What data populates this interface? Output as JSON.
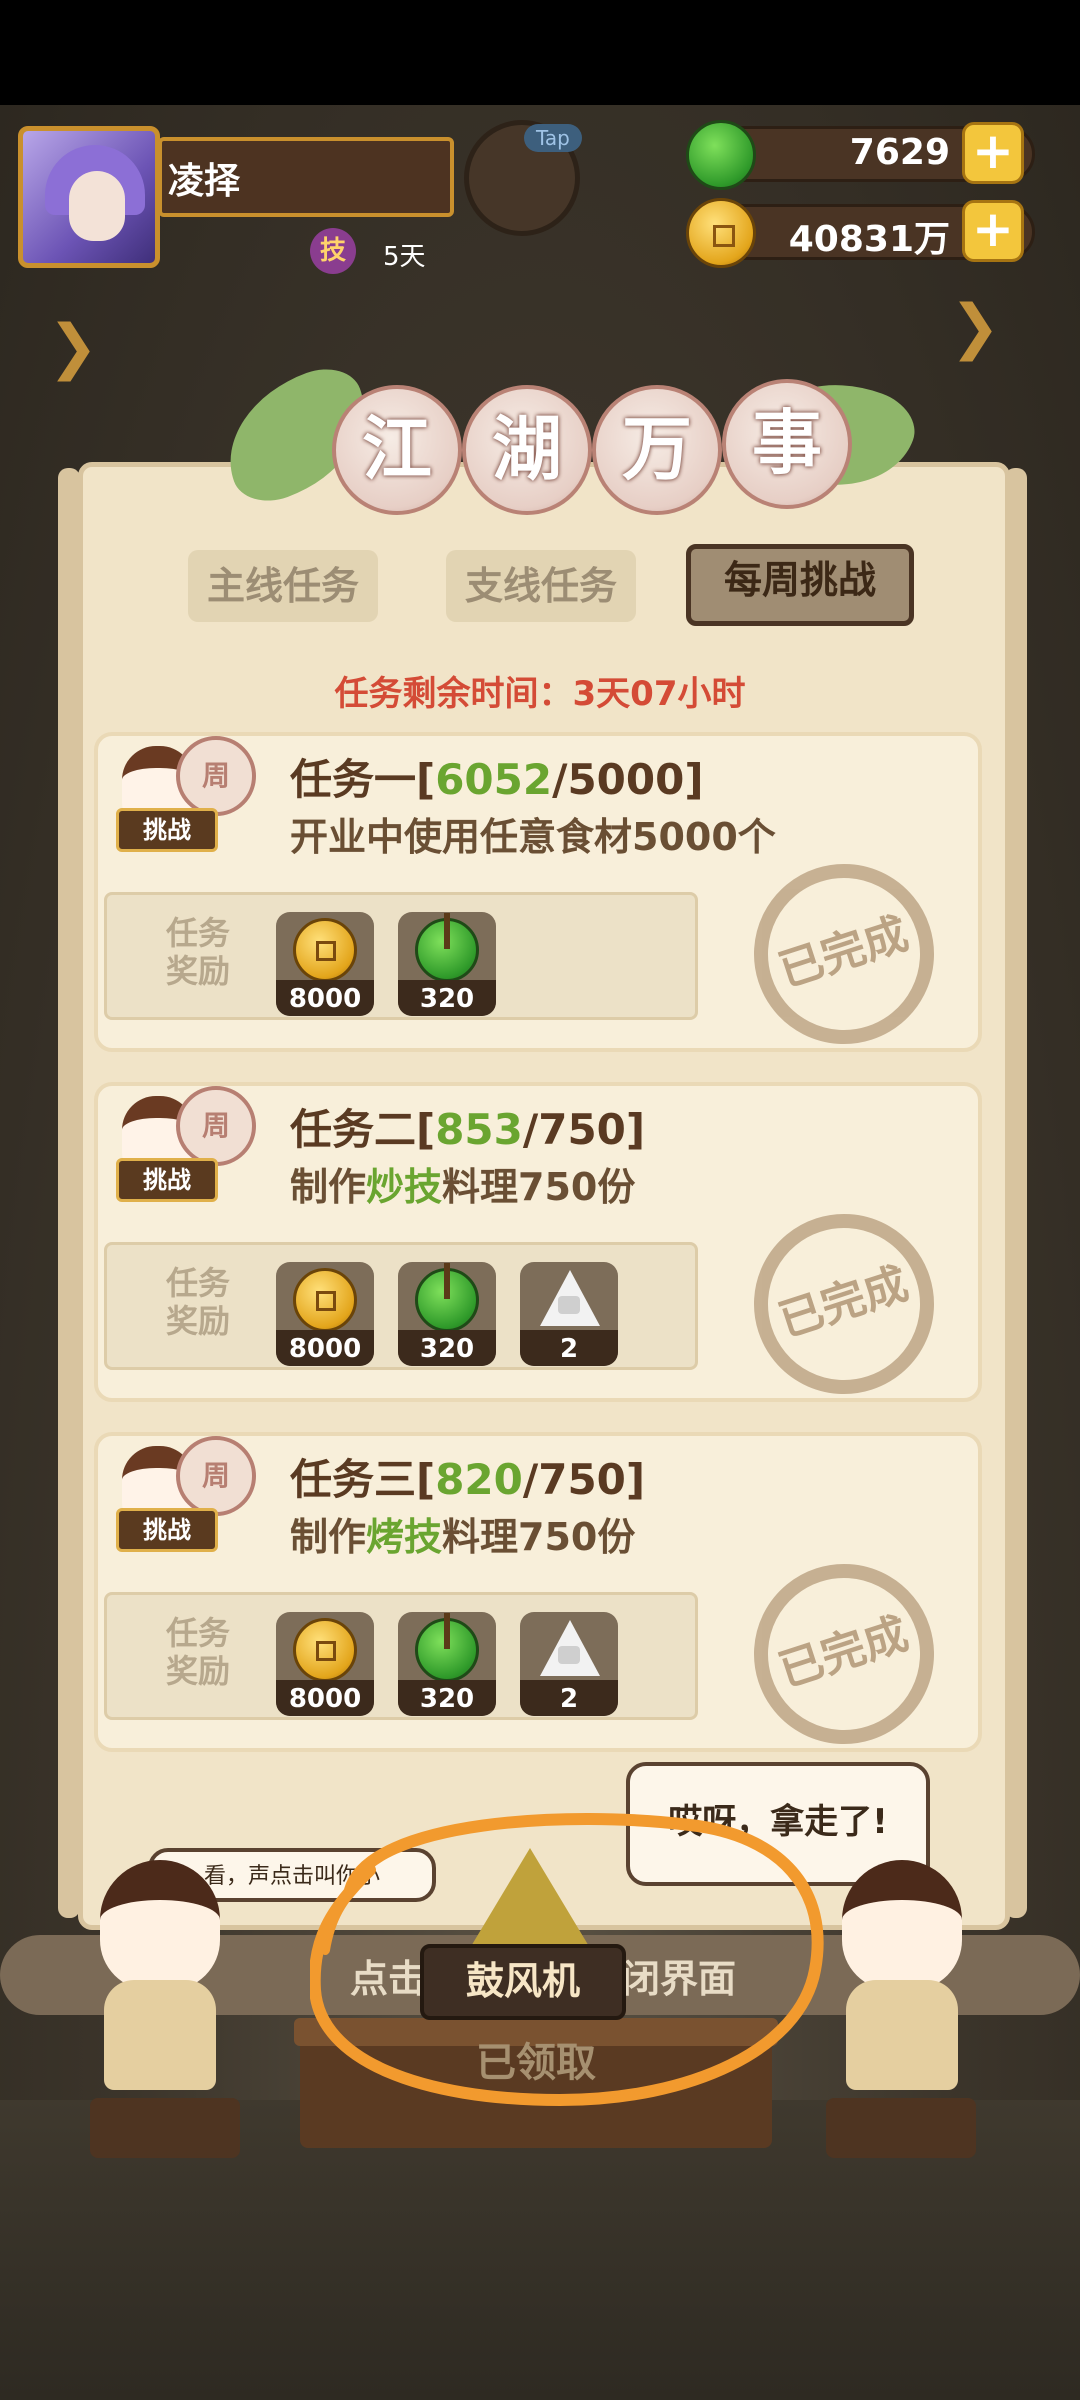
{
  "player": {
    "name": "凌择",
    "badge_glyph": "技",
    "days": "5天",
    "tap_label": "Tap"
  },
  "currency": [
    {
      "icon": "jade-icon",
      "value": "7629"
    },
    {
      "icon": "coin-icon",
      "value": "40831万"
    }
  ],
  "plus_glyph": "+",
  "title_chars": [
    "江",
    "湖",
    "万",
    "事"
  ],
  "tabs": [
    {
      "label": "主线任务",
      "active": false
    },
    {
      "label": "支线任务",
      "active": false
    },
    {
      "label": "每周挑战",
      "active": true
    }
  ],
  "timer": "任务剩余时间：3天07小时",
  "reward_label": "任务\n奖励",
  "challenge_tag": "挑战",
  "drum_glyph": "周",
  "status_stamp": "已完成",
  "tasks": [
    {
      "prefix": "任务一[",
      "progress": "6052",
      "goal": "/5000]",
      "desc_a": "开业中使用任意食材5000个",
      "desc_highlight": "",
      "desc_b": "",
      "rewards": [
        {
          "type": "coin",
          "count": "8000"
        },
        {
          "type": "jade",
          "count": "320"
        }
      ]
    },
    {
      "prefix": "任务二[",
      "progress": "853",
      "goal": "/750]",
      "desc_a": "制作",
      "desc_highlight": "炒技",
      "desc_b": "料理750份",
      "rewards": [
        {
          "type": "coin",
          "count": "8000"
        },
        {
          "type": "jade",
          "count": "320"
        },
        {
          "type": "rice",
          "count": "2"
        }
      ]
    },
    {
      "prefix": "任务三[",
      "progress": "820",
      "goal": "/750]",
      "desc_a": "制作",
      "desc_highlight": "烤技",
      "desc_b": "料理750份",
      "rewards": [
        {
          "type": "coin",
          "count": "8000"
        },
        {
          "type": "jade",
          "count": "320"
        },
        {
          "type": "rice",
          "count": "2"
        }
      ]
    }
  ],
  "bottom": {
    "bubble_right": "哎呀，拿走了!",
    "bubble_left": "看，声点击叫你小",
    "counter_left": "点击",
    "counter_right": "闭界面",
    "item_name": "鼓风机",
    "claimed": "已领取"
  },
  "colors": {
    "accent_orange": "#f29a2e",
    "timer_red": "#d44b36",
    "progress_green": "#6aa530"
  }
}
